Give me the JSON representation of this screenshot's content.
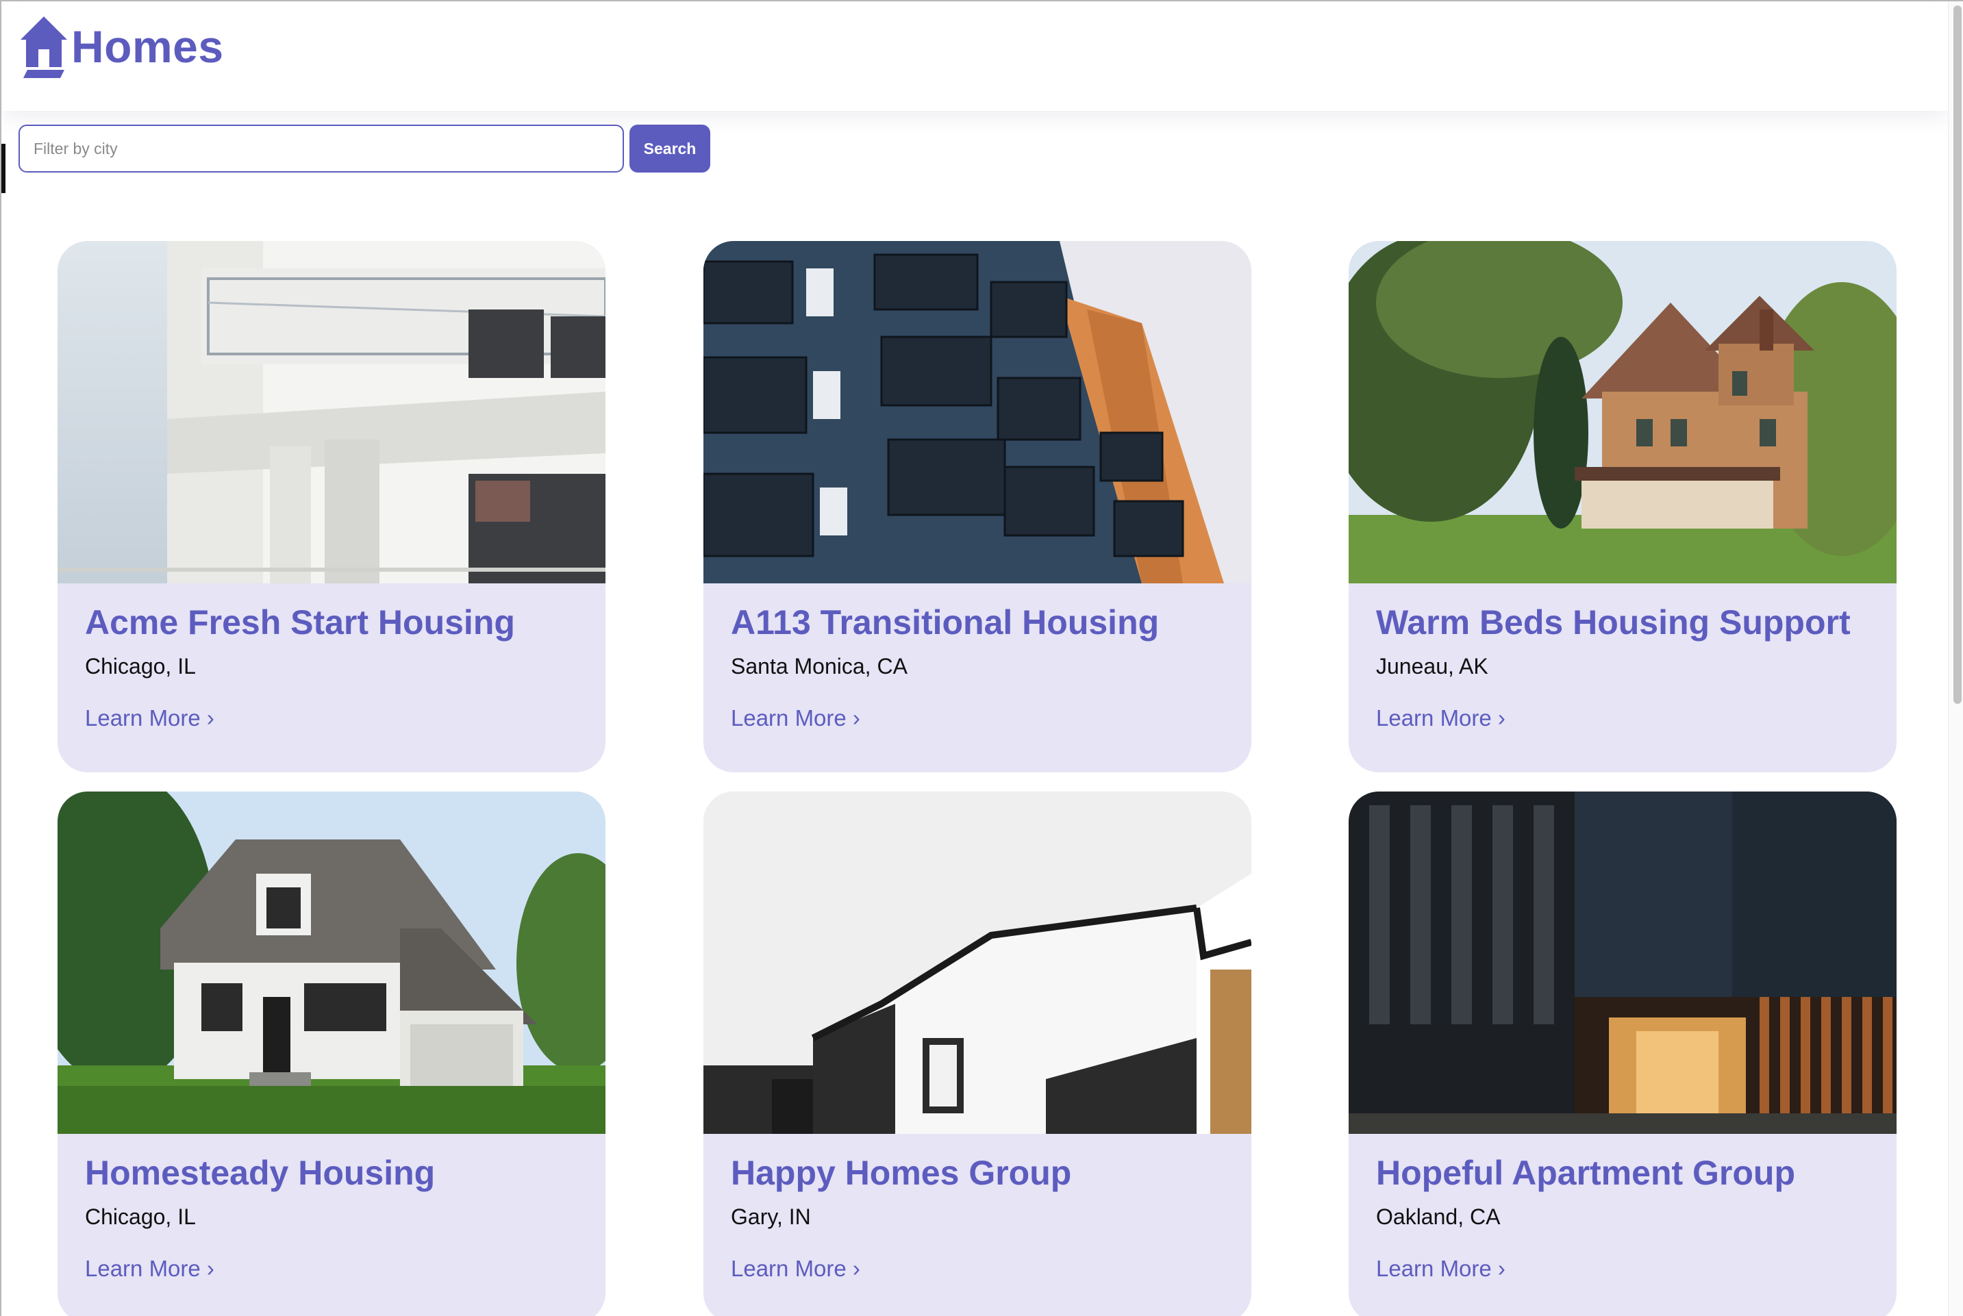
{
  "header": {
    "brand_name": "Homes",
    "logo_icon": "house-icon"
  },
  "search": {
    "placeholder": "Filter by city",
    "value": "",
    "button_label": "Search"
  },
  "colors": {
    "accent": "#5c5cbf",
    "card_background": "#e6e4f5",
    "text_dark": "#111111"
  },
  "listings": [
    {
      "name": "Acme Fresh Start Housing",
      "city": "Chicago, IL",
      "link_label": "Learn More ›",
      "photo": "white modern apartment building with glass balconies"
    },
    {
      "name": "A113 Transitional Housing",
      "city": "Santa Monica, CA",
      "link_label": "Learn More ›",
      "photo": "blue and orange apartment facade with balconies"
    },
    {
      "name": "Warm Beds Housing Support",
      "city": "Juneau, AK",
      "link_label": "Learn More ›",
      "photo": "victorian brick house among trees"
    },
    {
      "name": "Homesteady Housing",
      "city": "Chicago, IL",
      "link_label": "Learn More ›",
      "photo": "white cottage house with gray roof and lawn"
    },
    {
      "name": "Happy Homes Group",
      "city": "Gary, IN",
      "link_label": "Learn More ›",
      "photo": "minimal white and black modern houses"
    },
    {
      "name": "Hopeful Apartment Group",
      "city": "Oakland, CA",
      "link_label": "Learn More ›",
      "photo": "dark modern building with wood slat entrance"
    }
  ]
}
